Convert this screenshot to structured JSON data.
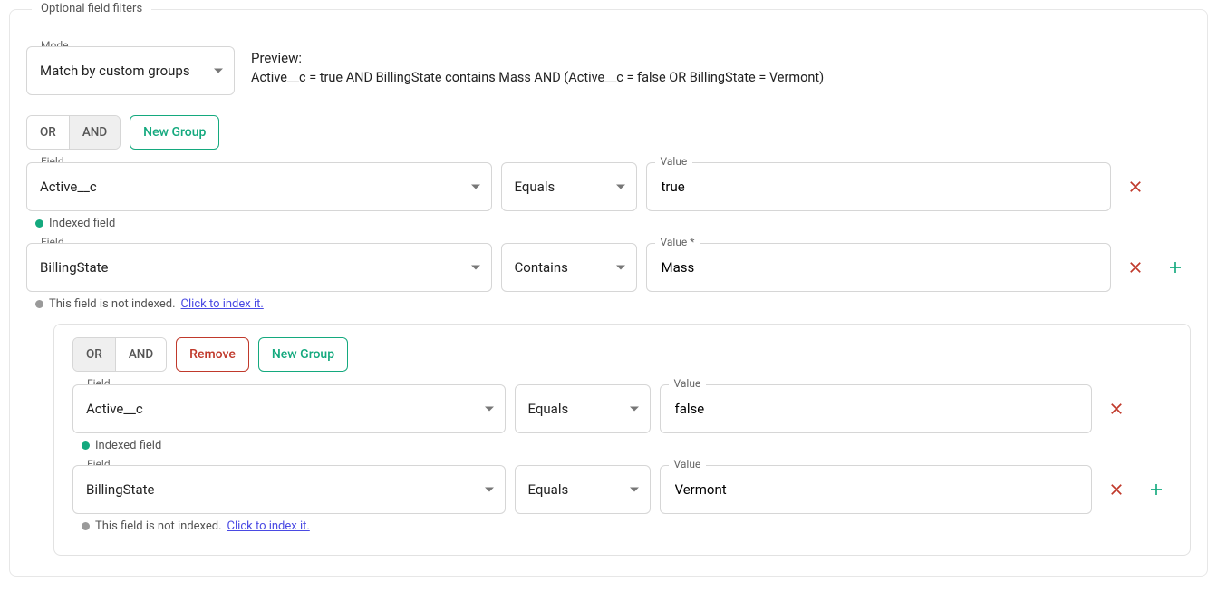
{
  "legend": "Optional field filters",
  "mode": {
    "label": "Mode",
    "value": "Match by custom groups"
  },
  "preview": {
    "title": "Preview:",
    "text": "Active__c = true AND BillingState contains Mass AND (Active__c = false OR BillingState = Vermont)"
  },
  "buttons": {
    "or": "OR",
    "and": "AND",
    "newGroup": "New Group",
    "remove": "Remove"
  },
  "labels": {
    "field": "Field",
    "value": "Value",
    "valueReq": "Value *"
  },
  "hints": {
    "indexed": "Indexed field",
    "notIndexed": "This field is not indexed.",
    "indexLink": "Click to index it."
  },
  "outer": {
    "activeTab": "AND",
    "rows": [
      {
        "field": "Active__c",
        "op": "Equals",
        "value": "true",
        "indexed": true,
        "icons": [
          "x"
        ]
      },
      {
        "field": "BillingState",
        "op": "Contains",
        "value": "Mass",
        "valueReq": true,
        "indexed": false,
        "icons": [
          "x",
          "plus"
        ]
      }
    ]
  },
  "inner": {
    "activeTab": "OR",
    "rows": [
      {
        "field": "Active__c",
        "op": "Equals",
        "value": "false",
        "indexed": true,
        "icons": [
          "x"
        ]
      },
      {
        "field": "BillingState",
        "op": "Equals",
        "value": "Vermont",
        "indexed": false,
        "icons": [
          "x",
          "plus"
        ]
      }
    ]
  }
}
